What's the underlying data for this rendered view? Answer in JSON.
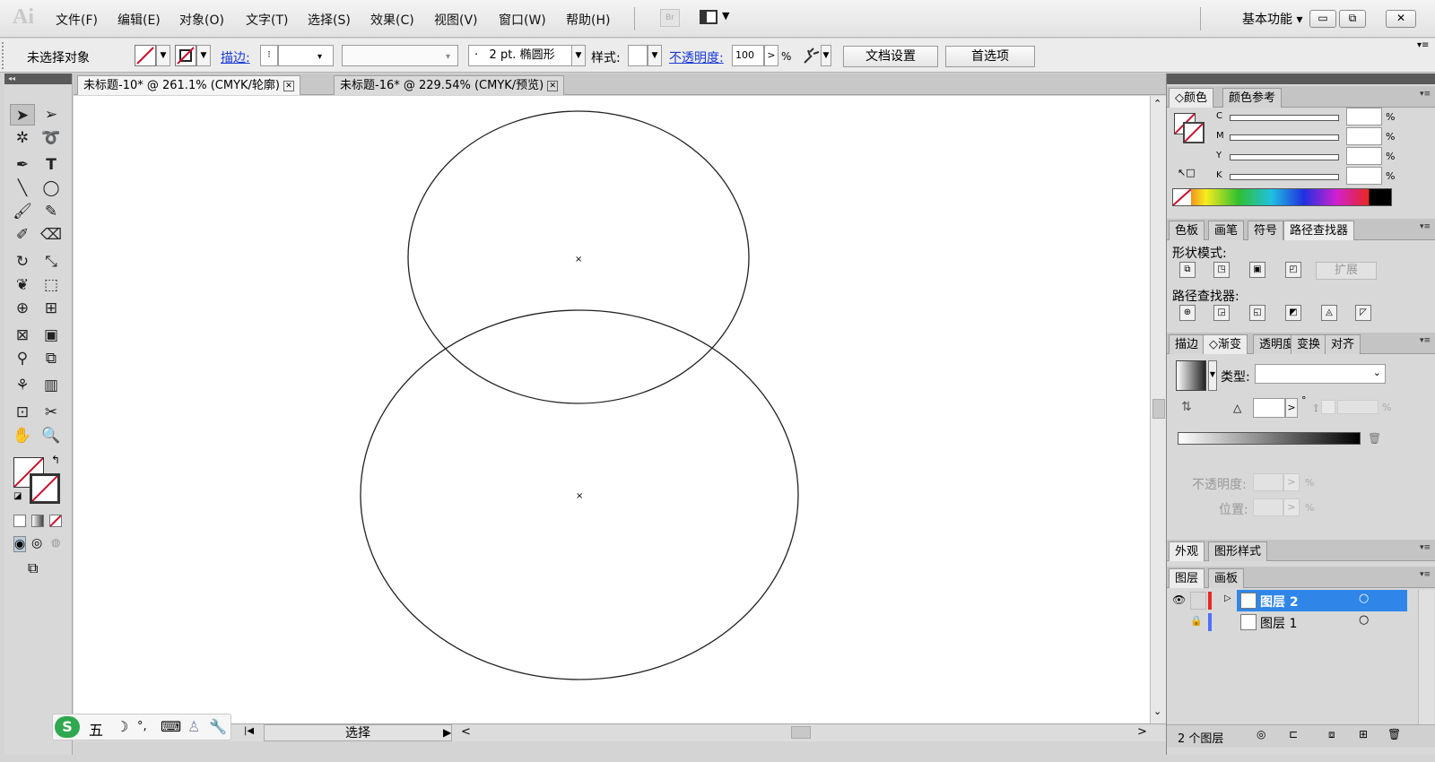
{
  "app": {
    "logo": "Ai"
  },
  "menus": [
    "文件(F)",
    "编辑(E)",
    "对象(O)",
    "文字(T)",
    "选择(S)",
    "效果(C)",
    "视图(V)",
    "窗口(W)",
    "帮助(H)"
  ],
  "menubar": {
    "br_label": "Br",
    "workspace": "基本功能"
  },
  "window_controls": {
    "minimize": "▭",
    "restore": "⧉",
    "close": "✕"
  },
  "control_bar": {
    "selection_status": "未选择对象",
    "stroke_label": "描边:",
    "stroke_weight_stepper": "⁝",
    "brush_label": "2 pt. 椭圆形",
    "brush_bullet": "·",
    "style_label": "样式:",
    "opacity_label": "不透明度:",
    "opacity_value": "100",
    "opacity_arrow": ">",
    "opacity_unit": "%",
    "doc_setup_button": "文档设置",
    "preferences_button": "首选项"
  },
  "tabs": [
    {
      "title": "未标题-10* @ 261.1% (CMYK/轮廓)",
      "active": true
    },
    {
      "title": "未标题-16* @ 229.54% (CMYK/预览)",
      "active": false
    }
  ],
  "tab_close": "✕",
  "canvas": {
    "shapes": [
      {
        "kind": "ellipse",
        "name": "small-circle"
      },
      {
        "kind": "ellipse",
        "name": "large-circle"
      }
    ]
  },
  "status_bar": {
    "tool_name": "选择",
    "arrow_right": "▶",
    "scroll_left": "<",
    "scroll_right": ">",
    "nav": "|◀"
  },
  "panels": {
    "color": {
      "tabs": [
        "颜色",
        "颜色参考"
      ],
      "tab_prefix": "◇",
      "channels": [
        "C",
        "M",
        "Y",
        "K"
      ],
      "unit": "%"
    },
    "swatches_group": {
      "tabs": [
        "色板",
        "画笔",
        "符号",
        "路径查找器"
      ]
    },
    "pathfinder": {
      "shape_modes_label": "形状模式:",
      "expand_button": "扩展",
      "pathfinders_label": "路径查找器:"
    },
    "gradient_group": {
      "tabs": [
        "描边",
        "渐变",
        "透明度",
        "变换",
        "对齐"
      ],
      "tab_prefix": "◇",
      "type_label": "类型:",
      "angle_icon": "△",
      "degree_symbol": "°",
      "reverse_icon": "⇅",
      "trash_icon": "🗑",
      "opacity_label": "不透明度:",
      "location_label": "位置:",
      "unit": "%"
    },
    "appearance": {
      "tabs": [
        "外观",
        "图形样式"
      ]
    },
    "layers": {
      "tabs": [
        "图层",
        "画板"
      ],
      "rows": [
        {
          "name": "图层 2",
          "selected": true,
          "color": "#e8281e"
        },
        {
          "name": "图层 1",
          "selected": false,
          "color": "#4f6fff"
        }
      ],
      "count_label": "2 个图层"
    }
  },
  "ime": {
    "five": "五",
    "moon": "☽",
    "punct": "°,",
    "keyboard": "⌨",
    "person": "♙",
    "wrench": "🔧"
  },
  "colors": {
    "selection_blue": "#2f86e8",
    "link_blue": "#1a3bd6",
    "no_fill_red": "#c8102e"
  }
}
